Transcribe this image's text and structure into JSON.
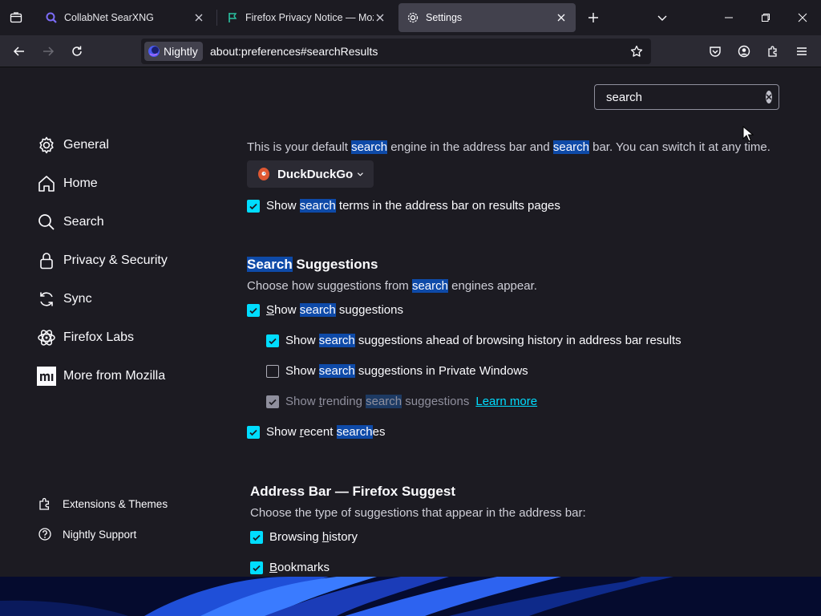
{
  "tabs": [
    {
      "title": "CollabNet SearXNG",
      "selected": false
    },
    {
      "title": "Firefox Privacy Notice — Mozilla",
      "selected": false
    },
    {
      "title": "Settings",
      "selected": true
    }
  ],
  "toolbar": {
    "identity_label": "Nightly",
    "url": "about:preferences#searchResults"
  },
  "search": {
    "value": "search"
  },
  "sidebar": {
    "items": [
      {
        "label": "General",
        "icon": "gear-icon"
      },
      {
        "label": "Home",
        "icon": "home-icon"
      },
      {
        "label": "Search",
        "icon": "search-icon"
      },
      {
        "label": "Privacy & Security",
        "icon": "lock-icon"
      },
      {
        "label": "Sync",
        "icon": "sync-icon"
      },
      {
        "label": "Firefox Labs",
        "icon": "labs-icon"
      },
      {
        "label": "More from Mozilla",
        "icon": "mozilla-icon"
      }
    ],
    "footer": [
      {
        "label": "Extensions & Themes",
        "icon": "puzzle-icon"
      },
      {
        "label": "Nightly Support",
        "icon": "help-icon"
      }
    ]
  },
  "default_engine": {
    "desc": {
      "p1": "This is your default ",
      "h1": "search",
      "p2": " engine in the address bar and ",
      "h2": "search",
      "p3": " bar. You can switch it at any time."
    },
    "engine_name": "DuckDuckGo",
    "show_terms": {
      "p1": "Show ",
      "h1": "search",
      "p2": " terms in the address bar on results pages",
      "checked": true
    }
  },
  "suggestions": {
    "heading": {
      "h1": "Search",
      "p1": " Suggestions"
    },
    "desc": {
      "p1": "Choose how suggestions from ",
      "h1": "search",
      "p2": " engines appear."
    },
    "show_suggestions": {
      "p1": "how ",
      "h1": "search",
      "p2": " suggestions",
      "accesskey": "S",
      "checked": true
    },
    "ahead_history": {
      "p1": "Show ",
      "h1": "search",
      "p2": " suggestions ahead of browsing history in address bar results",
      "checked": true
    },
    "private_windows": {
      "p1": "Show ",
      "h1": "search",
      "p2": " suggestions in Private Windows",
      "checked": false
    },
    "trending": {
      "p1": "Show ",
      "accesskey": "t",
      "p1b": "rending ",
      "h1": "search",
      "p2": " suggestions",
      "link": "Learn more",
      "checked": true,
      "disabled": true
    },
    "recent": {
      "p1": "Show ",
      "accesskey": "r",
      "p1b": "ecent ",
      "h1": "search",
      "p2": "es",
      "checked": true
    }
  },
  "address_bar": {
    "heading": "Address Bar — Firefox Suggest",
    "desc": "Choose the type of suggestions that appear in the address bar:",
    "browsing_history": {
      "p1": "Browsing ",
      "accesskey": "h",
      "p2": "istory",
      "checked": true
    },
    "bookmarks": {
      "accesskey": "B",
      "p2": "ookmarks",
      "checked": true
    }
  },
  "colors": {
    "accent": "#00ddff",
    "highlight": "#0e4aa8",
    "background": "#1c1b22",
    "toolbar": "#2b2a33"
  }
}
